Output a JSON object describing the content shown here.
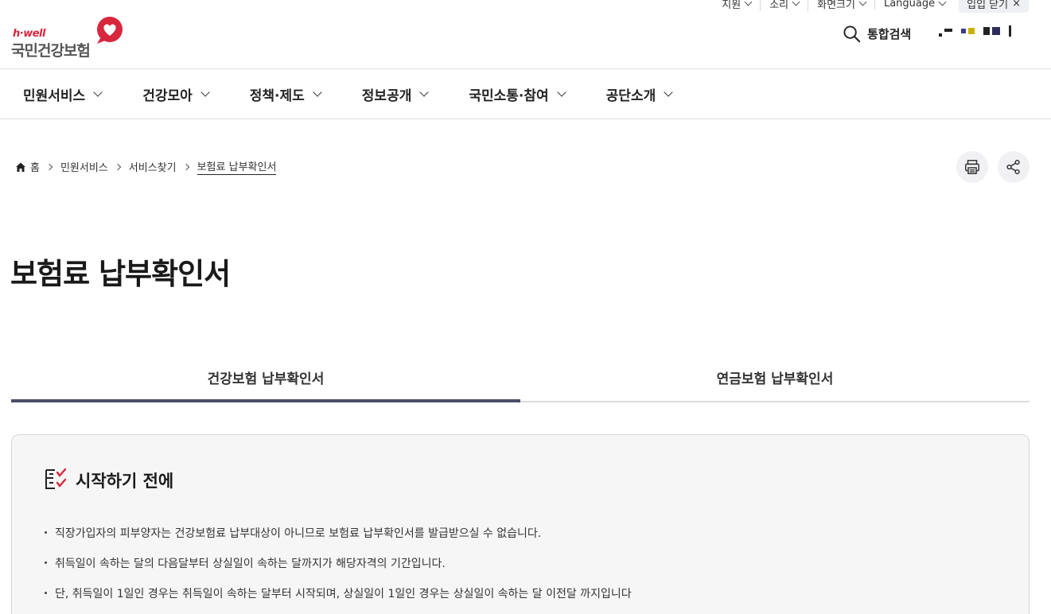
{
  "utility": {
    "items": [
      "지원",
      "소리",
      "화면크기",
      "Language"
    ],
    "close_label": "입입 닫기"
  },
  "brand": {
    "logo_en": "h·well",
    "logo_ko": "국민건강보험",
    "accent_color": "#d7263d"
  },
  "header": {
    "search_label": "통합검색"
  },
  "gnb": {
    "items": [
      "민원서비스",
      "건강모아",
      "정책·제도",
      "정보공개",
      "국민소통·참여",
      "공단소개"
    ]
  },
  "breadcrumb": {
    "items": [
      "홈",
      "민원서비스",
      "서비스찾기",
      "보험료 납부확인서"
    ]
  },
  "page": {
    "title": "보험료 납부확인서"
  },
  "tabs": [
    {
      "label": "건강보험 납부확인서",
      "active": true
    },
    {
      "label": "연금보험 납부확인서",
      "active": false
    }
  ],
  "notice": {
    "heading": "시작하기 전에",
    "items": [
      "직장가입자의 피부양자는 건강보험료 납부대상이 아니므로 보험료 납부확인서를 발급받으실 수 없습니다.",
      "취득일이 속하는 달의 다음달부터 상실일이 속하는 달까지가 해당자격의 기간입니다.",
      "단, 취득일이 1일인 경우는 취득일이 속하는 달부터 시작되며, 상실일이 1일인 경우는 상실일이 속하는 달 이전달 까지입니다"
    ]
  }
}
